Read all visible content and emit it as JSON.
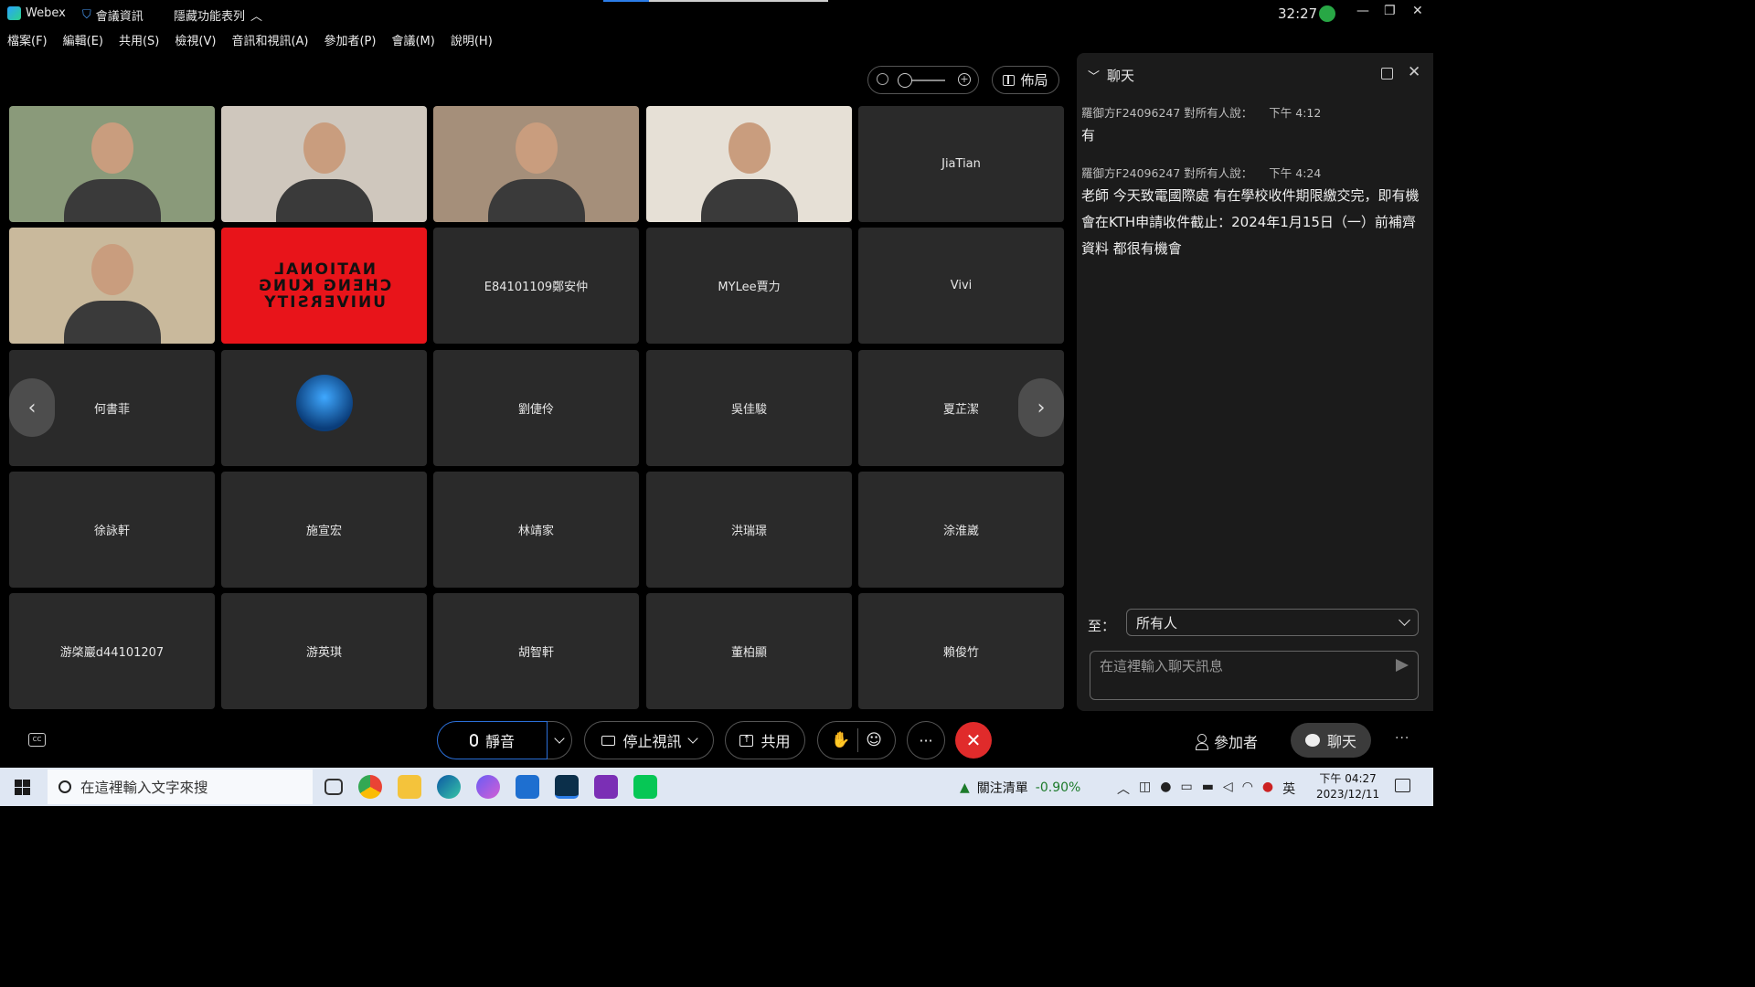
{
  "titlebar": {
    "app_name": "Webex",
    "meeting_info": "會議資訊",
    "hide_toolbar": "隱藏功能表列",
    "timer": "32:27"
  },
  "menu": [
    "檔案(F)",
    "編輯(E)",
    "共用(S)",
    "檢視(V)",
    "音訊和視訊(A)",
    "參加者(P)",
    "會議(M)",
    "說明(H)"
  ],
  "grid": {
    "layout_label": "佈局",
    "tiles": [
      {
        "name": "",
        "video": true,
        "bg": "#8a9a7a"
      },
      {
        "name": "",
        "video": true,
        "bg": "#cfc7bd"
      },
      {
        "name": "",
        "video": true,
        "bg": "#a58f7a"
      },
      {
        "name": "",
        "video": true,
        "bg": "#e6e0d6"
      },
      {
        "name": "JiaTian",
        "video": false
      },
      {
        "name": "",
        "video": true,
        "bg": "#c9b99c"
      },
      {
        "name": "",
        "video": true,
        "bg": "#e8141a",
        "banner": [
          "NATIONAL",
          "CHENG KUNG",
          "UNIVERSITY"
        ]
      },
      {
        "name": "E84101109鄭安仲",
        "video": false
      },
      {
        "name": "MYLee賈力",
        "video": false
      },
      {
        "name": "Vivi",
        "video": false
      },
      {
        "name": "何書菲",
        "video": false
      },
      {
        "name": "",
        "video": false,
        "avatar": true
      },
      {
        "name": "劉倢伶",
        "video": false
      },
      {
        "name": "吳佳駿",
        "video": false
      },
      {
        "name": "夏芷潔",
        "video": false
      },
      {
        "name": "徐詠軒",
        "video": false
      },
      {
        "name": "施宣宏",
        "video": false
      },
      {
        "name": "林靖家",
        "video": false
      },
      {
        "name": "洪瑞璟",
        "video": false
      },
      {
        "name": "涂淮崴",
        "video": false
      },
      {
        "name": "游棨巖d44101207",
        "video": false
      },
      {
        "name": "游英琪",
        "video": false
      },
      {
        "name": "胡智軒",
        "video": false
      },
      {
        "name": "董柏顯",
        "video": false
      },
      {
        "name": "賴俊竹",
        "video": false
      }
    ]
  },
  "chat": {
    "title": "聊天",
    "messages": [
      {
        "header": "羅御方F24096247 對所有人說：",
        "time": "下午 4:12",
        "body": "有"
      },
      {
        "header": "羅御方F24096247 對所有人說：",
        "time": "下午 4:24",
        "body": "老師 今天致電國際處 有在學校收件期限繳交完，即有機會在KTH申請收件截止：2024年1月15日（一）前補齊資料 都很有機會"
      }
    ],
    "to_label": "至：",
    "to_value": "所有人",
    "input_placeholder": "在這裡輸入聊天訊息"
  },
  "controls": {
    "mute": "靜音",
    "stop_video": "停止視訊",
    "share": "共用",
    "more": "···",
    "participants": "參加者",
    "chat": "聊天"
  },
  "taskbar": {
    "search_placeholder": "在這裡輸入文字來搜",
    "watchlist": "關注清單",
    "change": "-0.90%",
    "ime": "英",
    "time": "下午 04:27",
    "date": "2023/12/11"
  }
}
